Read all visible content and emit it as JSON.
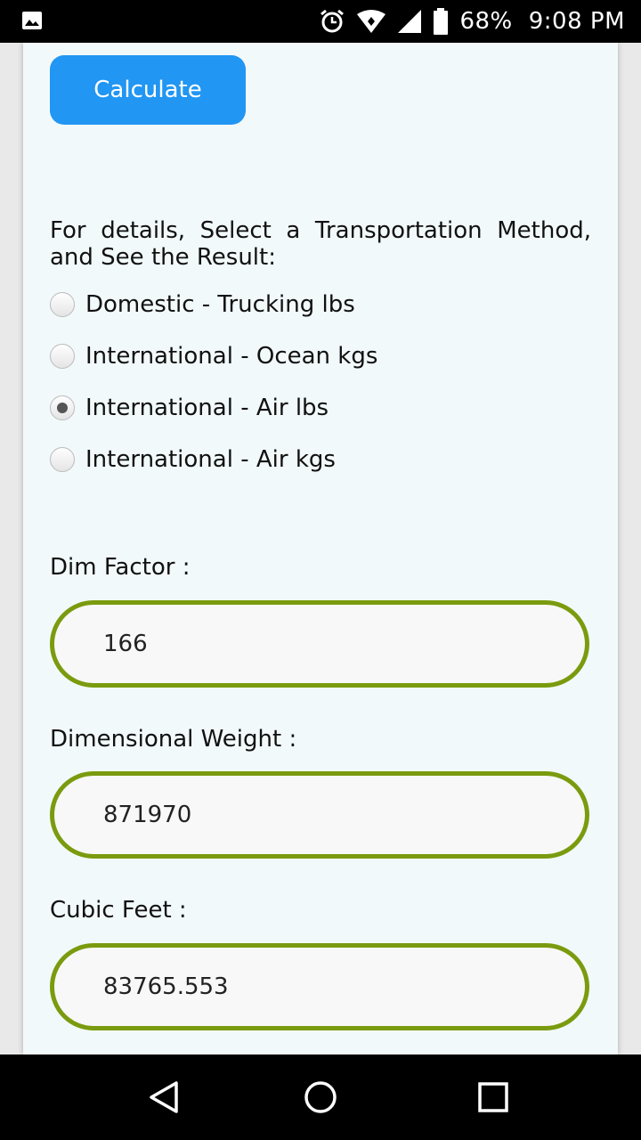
{
  "status_bar": {
    "battery": "68%",
    "time": "9:08 PM",
    "icons": [
      "gallery-icon",
      "alarm-icon",
      "wifi-icon",
      "signal-icon",
      "battery-icon"
    ]
  },
  "form": {
    "calculate_label": "Calculate",
    "details_text": "For details, Select a Transportation Method, and See the Result:",
    "methods": [
      {
        "label": "Domestic - Trucking lbs",
        "checked": false
      },
      {
        "label": "International - Ocean kgs",
        "checked": false
      },
      {
        "label": "International - Air lbs",
        "checked": true
      },
      {
        "label": "International - Air kgs",
        "checked": false
      }
    ],
    "dim_factor": {
      "label": "Dim Factor :",
      "value": "166"
    },
    "dimensional_weight": {
      "label": "Dimensional Weight :",
      "value": "871970"
    },
    "cubic_feet": {
      "label": "Cubic Feet :",
      "value": "83765.553"
    }
  },
  "colors": {
    "button_blue": "#2196f3",
    "field_border_green": "#7a9b0e",
    "page_background": "#f2f9fb"
  },
  "nav_bar": {
    "icons": [
      "back-icon",
      "home-icon",
      "recents-icon"
    ]
  }
}
